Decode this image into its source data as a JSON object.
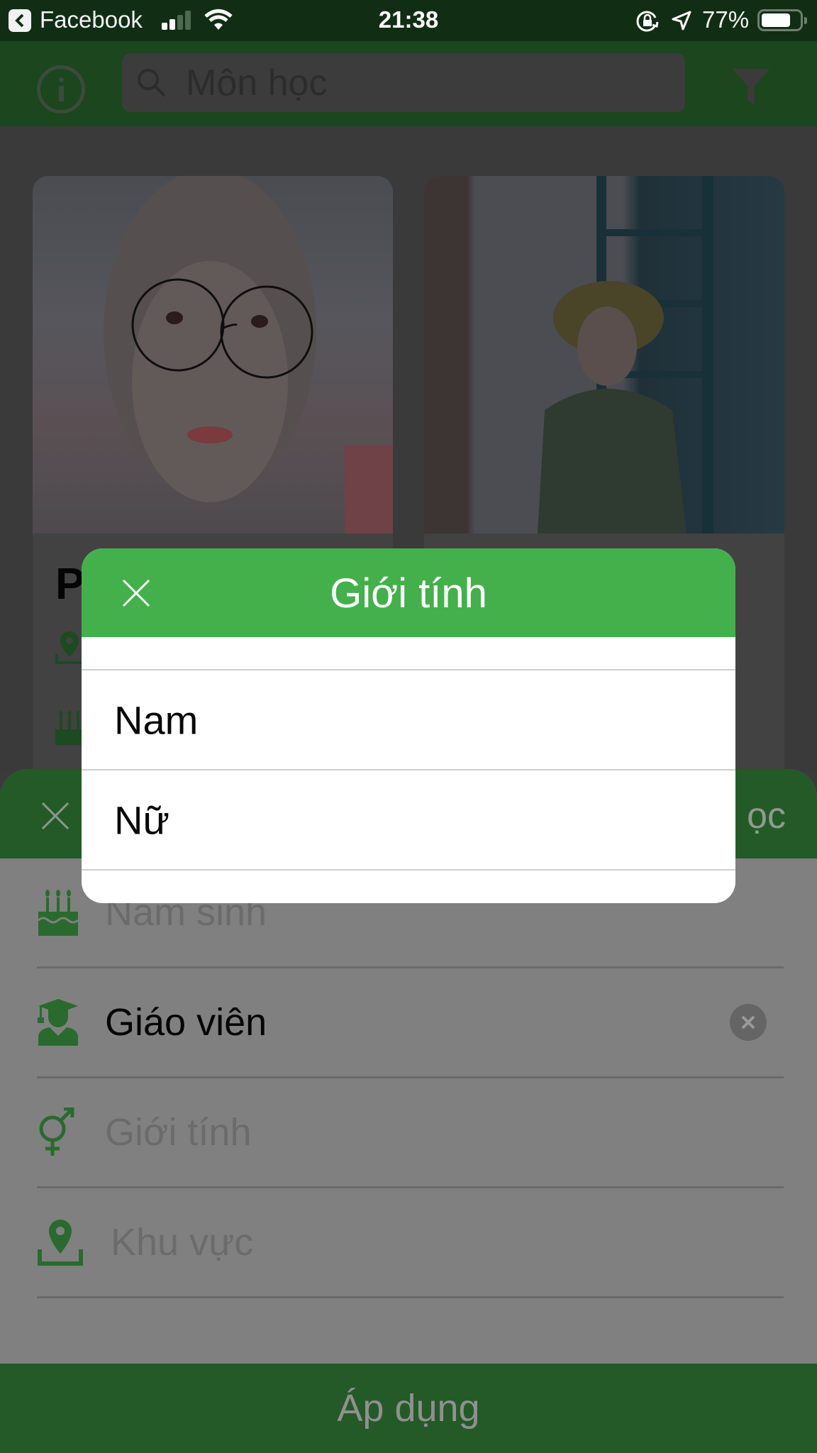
{
  "status_bar": {
    "back_app": "Facebook",
    "time": "21:38",
    "battery_percent": "77%",
    "battery_level": 0.77,
    "signal_bars_active": 2,
    "signal_bars_total": 4
  },
  "header": {
    "search_placeholder": "Môn học",
    "icons": [
      "info-icon",
      "search-icon",
      "filter-icon"
    ]
  },
  "cards": [
    {
      "name_partial": "P",
      "icons": [
        "location-icon",
        "birthday-cake-icon"
      ]
    },
    {
      "name_partial": "",
      "icons": []
    }
  ],
  "filter_sheet": {
    "title_partial": "ọc",
    "rows": [
      {
        "icon": "birthday-cake-icon",
        "label": "Năm sinh",
        "filled": false
      },
      {
        "icon": "teacher-icon",
        "label": "Giáo viên",
        "filled": true
      },
      {
        "icon": "gender-icon",
        "label": "Giới tính",
        "filled": false
      },
      {
        "icon": "location-icon",
        "label": "Khu vực",
        "filled": false
      }
    ],
    "apply_label": "Áp dụng"
  },
  "dialog": {
    "title": "Giới tính",
    "options": [
      "Nam",
      "Nữ"
    ]
  },
  "colors": {
    "dialog_header": "#44b04c",
    "sheet_header_dimmed": "#245a27",
    "icon_green_dimmed": "#2a6a2e",
    "overlay_gray": "#808080"
  }
}
